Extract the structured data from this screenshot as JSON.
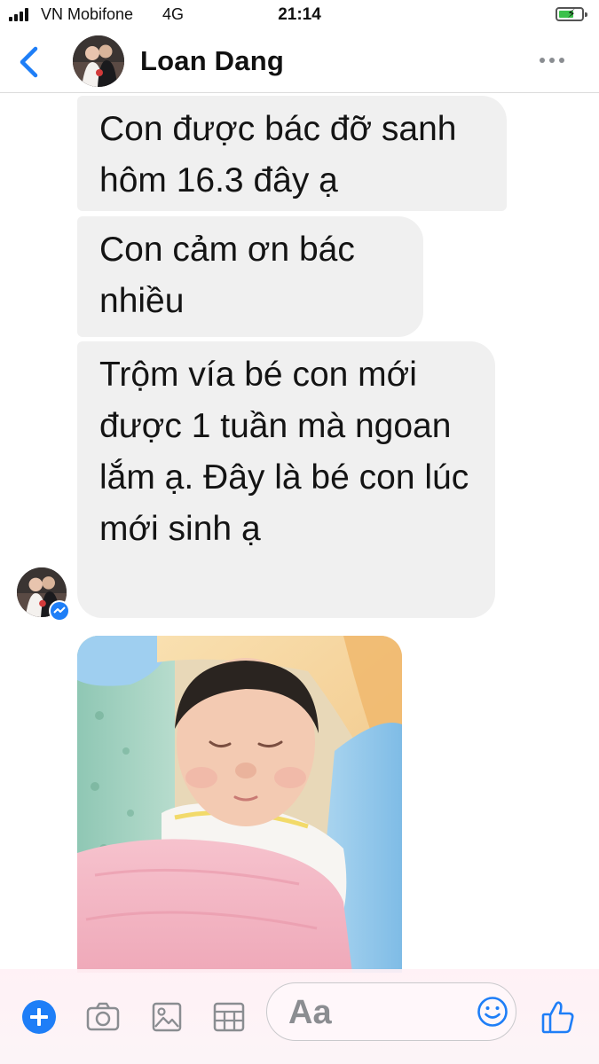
{
  "status_bar": {
    "carrier": "VN Mobifone",
    "network": "4G",
    "time": "21:14"
  },
  "header": {
    "contact_name": "Loan Dang"
  },
  "messages": [
    {
      "text": "Con được bác đỡ sanh hôm 16.3 đây ạ"
    },
    {
      "text": "Con cảm ơn bác nhiều"
    },
    {
      "text": "Trộm vía bé con mới được 1 tuần mà ngoan lắm ạ. Đây là bé con lúc mới sinh ạ"
    }
  ],
  "composer": {
    "placeholder": "Aa"
  },
  "colors": {
    "accent": "#1e7ef7",
    "bubble": "#f0f0f0",
    "battery": "#3cc14b"
  },
  "icons": [
    "signal-icon",
    "battery-icon",
    "back-icon",
    "more-icon",
    "messenger-badge-icon",
    "plus-icon",
    "camera-icon",
    "gallery-icon",
    "sticker-icon",
    "emoji-icon",
    "like-icon"
  ]
}
